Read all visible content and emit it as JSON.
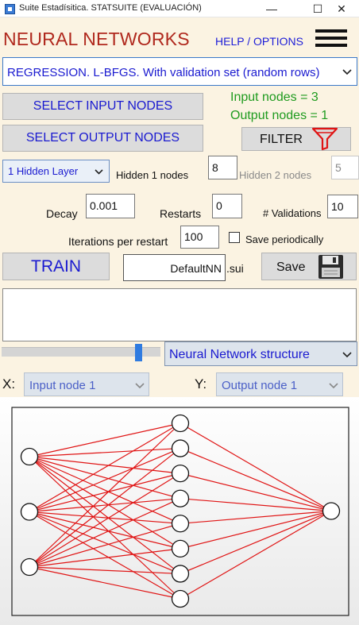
{
  "window": {
    "title": "Suite Estadísitica. STATSUITE (EVALUACIÓN)",
    "minimize_glyph": "—",
    "maximize_glyph": "☐",
    "close_glyph": "✕"
  },
  "header": {
    "title": "NEURAL NETWORKS",
    "help_link": "HELP / OPTIONS"
  },
  "mode_select": {
    "value": "REGRESSION. L-BFGS. With validation set (random rows)"
  },
  "nodes": {
    "select_input_label": "SELECT INPUT NODES",
    "select_output_label": "SELECT OUTPUT NODES",
    "input_count_text": "Input nodes = 3",
    "output_count_text": "Output nodes = 1",
    "filter_label": "FILTER"
  },
  "layers": {
    "value": "1 Hidden Layer",
    "hidden1_label": "Hidden 1 nodes",
    "hidden1_value": "8",
    "hidden2_label": "Hidden 2 nodes",
    "hidden2_value": "5"
  },
  "params": {
    "decay_label": "Decay",
    "decay_value": "0.001",
    "restarts_label": "Restarts",
    "restarts_value": "0",
    "validations_label": "# Validations",
    "validations_value": "10",
    "iterations_label": "Iterations per restart",
    "iterations_value": "100",
    "save_periodically_label": "Save periodically"
  },
  "actions": {
    "train_label": "TRAIN",
    "filename": "DefaultNN",
    "extension": ".sui",
    "save_label": "Save"
  },
  "view": {
    "value": "Neural Network structure",
    "slider_fraction": 0.88
  },
  "axes": {
    "x_label": "X:",
    "x_value": "Input node 1",
    "y_label": "Y:",
    "y_value": "Output node 1"
  },
  "network": {
    "input_nodes": 3,
    "hidden_nodes": 8,
    "output_nodes": 1
  },
  "colors": {
    "title": "#b0291e",
    "link": "#1a1ad0",
    "status_green": "#1f9b1f",
    "edge": "#e01414",
    "filter_icon": "#e01414",
    "slider": "#2f7be0"
  },
  "icons": {
    "menu": "hamburger-icon",
    "filter": "funnel-icon",
    "save": "floppy-disk-icon",
    "dropdown": "chevron-down-icon"
  }
}
